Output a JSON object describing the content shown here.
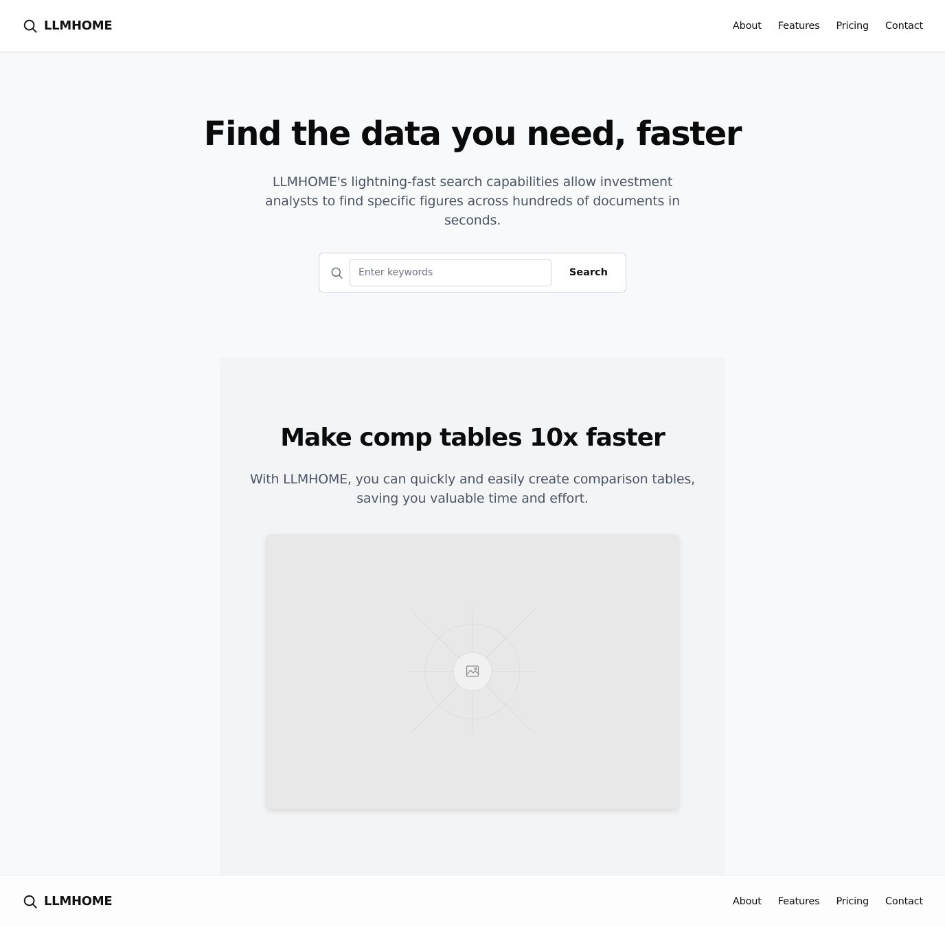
{
  "header": {
    "brand": "LLMHOME",
    "brand_icon": "search-icon",
    "nav": [
      "About",
      "Features",
      "Pricing",
      "Contact"
    ]
  },
  "hero": {
    "title": "Find the data you need, faster",
    "subtitle": "LLMHOME's lightning-fast search capabilities allow investment analysts to find specific figures across hundreds of documents in seconds.",
    "search": {
      "placeholder": "Enter keywords",
      "value": "",
      "button_label": "Search",
      "icon": "search-icon"
    }
  },
  "feature": {
    "title": "Make comp tables 10x faster",
    "subtitle": "With LLMHOME, you can quickly and easily create comparison tables, saving you valuable time and effort.",
    "image_icon": "image-placeholder-icon"
  },
  "footer": {
    "brand": "LLMHOME",
    "brand_icon": "search-icon",
    "nav": [
      "About",
      "Features",
      "Pricing",
      "Contact"
    ]
  },
  "colors": {
    "page_bg": "#f8f9fa",
    "section_bg": "#f3f4f6",
    "text_primary": "#0b0b0b",
    "text_muted": "#4b5563",
    "border": "#d1d5db"
  }
}
